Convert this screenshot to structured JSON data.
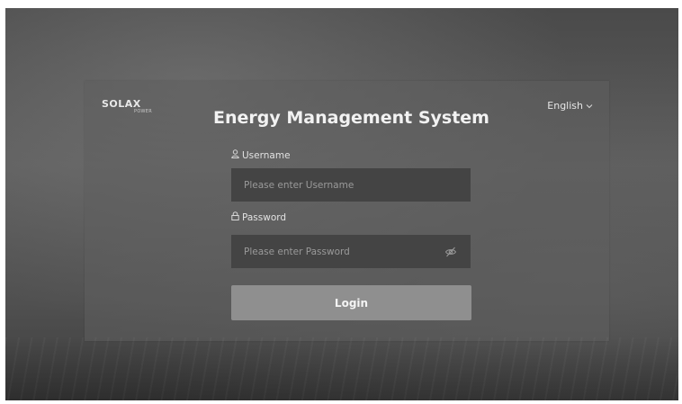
{
  "brand": {
    "logo_main": "SOLAX",
    "logo_sub": "POWER"
  },
  "language": {
    "selected": "English",
    "icon": "chevron-down-icon"
  },
  "login_form": {
    "title": "Energy Management System",
    "username": {
      "label": "Username",
      "icon": "user-icon",
      "placeholder": "Please enter Username",
      "value": ""
    },
    "password": {
      "label": "Password",
      "icon": "lock-icon",
      "placeholder": "Please enter Password",
      "value": "",
      "toggle_icon": "eye-off-icon"
    },
    "submit_label": "Login"
  },
  "colors": {
    "panel_bg": "#5f5f5f",
    "input_bg": "#444444",
    "button_bg": "#8f8f8f",
    "text": "#f2f2f2"
  }
}
